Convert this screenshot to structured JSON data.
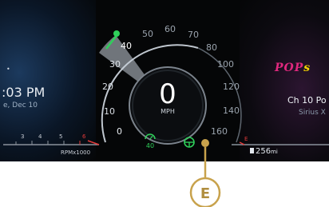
{
  "clock": {
    "time": ":03 PM",
    "date": "e, Dec 10"
  },
  "speedometer": {
    "speed": "0",
    "unit": "MPH",
    "ticks": [
      "0",
      "10",
      "20",
      "30",
      "40",
      "50",
      "60",
      "70",
      "80",
      "100",
      "120",
      "140",
      "160"
    ],
    "set_speed": "40"
  },
  "tachometer": {
    "ticks": [
      "3",
      "4",
      "5",
      "6"
    ],
    "unit": "RPMx1000"
  },
  "media": {
    "logo_main": "POP",
    "logo_tail": "s",
    "channel": "Ch 10 Po",
    "station": "Sirius X"
  },
  "fuel": {
    "range_value": "256",
    "range_unit": "mi",
    "gauge_label": "E"
  },
  "callout": {
    "label": "E"
  },
  "colors": {
    "accent_green": "#2fd05a",
    "callout_gold": "#c8a24c",
    "logo_pink": "#e0287e",
    "fuel_red": "#e23a3a"
  },
  "icons": {
    "clock_dot": "•",
    "cruise": "cruise-control-icon",
    "lane": "lane-keep-steering-icon",
    "fuel": "fuel-pump-icon"
  }
}
